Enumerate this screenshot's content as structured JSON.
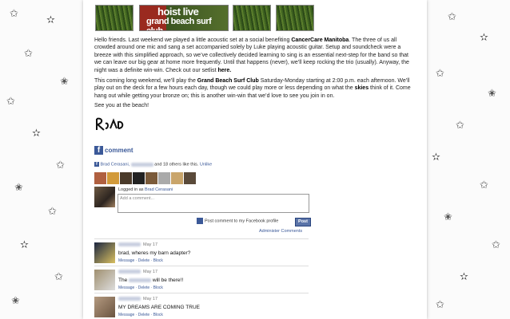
{
  "banner": {
    "line1": "hoist live",
    "line2": "grand beach surf club"
  },
  "post": {
    "p1_a": "Hello friends. Last weekend we played a little acoustic set at a social benefiting ",
    "p1_b": "CancerCare Manitoba",
    "p1_c": ". The three of us all crowded around one mic and sang a set accompanied solely by Luke playing acoustic guitar. Setup and soundcheck were a breeze with this simplified approach, so we’ve collectively decided learning to sing is an essential next-step for the band so that we can leave our big gear at home more frequently. Until that happens (never), we’ll keep rocking the trio (usually). Anyway, the night was a definite win-win. Check out our setlist ",
    "p1_d": "here.",
    "p2_a": "This coming long weekend, we’ll play the ",
    "p2_b": "Grand Beach Surf Club",
    "p2_c": " Saturday-Monday starting at 2:00 p.m. each afternoon. We’ll play out on the deck for a few hours each day, though we could play more or less depending on what the ",
    "p2_d": "skies",
    "p2_e": " think of it. Come hang out while getting your bronze on; this is another win-win that we’d love to see you join in on.",
    "p3": "See you at the beach!"
  },
  "comments_widget": {
    "title": "comment",
    "likes_name": "Brad Cerasani,",
    "likes_suffix": "and 18 others like this.",
    "unlike": "Unlike",
    "logged_in_prefix": "Logged in as",
    "logged_in_name": "Brad Cerasani",
    "placeholder": "Add a comment...",
    "post_to_profile": "Post comment to my Facebook profile",
    "post_button": "Post",
    "admin_link": "Administer Comments",
    "actions": [
      "Message",
      "Delete",
      "Block"
    ],
    "items": [
      {
        "date": "May 17",
        "text": "brad, wheres my barn adapter?"
      },
      {
        "date": "May 17",
        "text_prefix": "The",
        "text_suffix": "will be there!!"
      },
      {
        "date": "May 17",
        "text": "MY DREAMS ARE COMING TRUE"
      }
    ]
  },
  "colors": {
    "fb_blue": "#3b5998",
    "accent_red": "#9a2a1f"
  }
}
